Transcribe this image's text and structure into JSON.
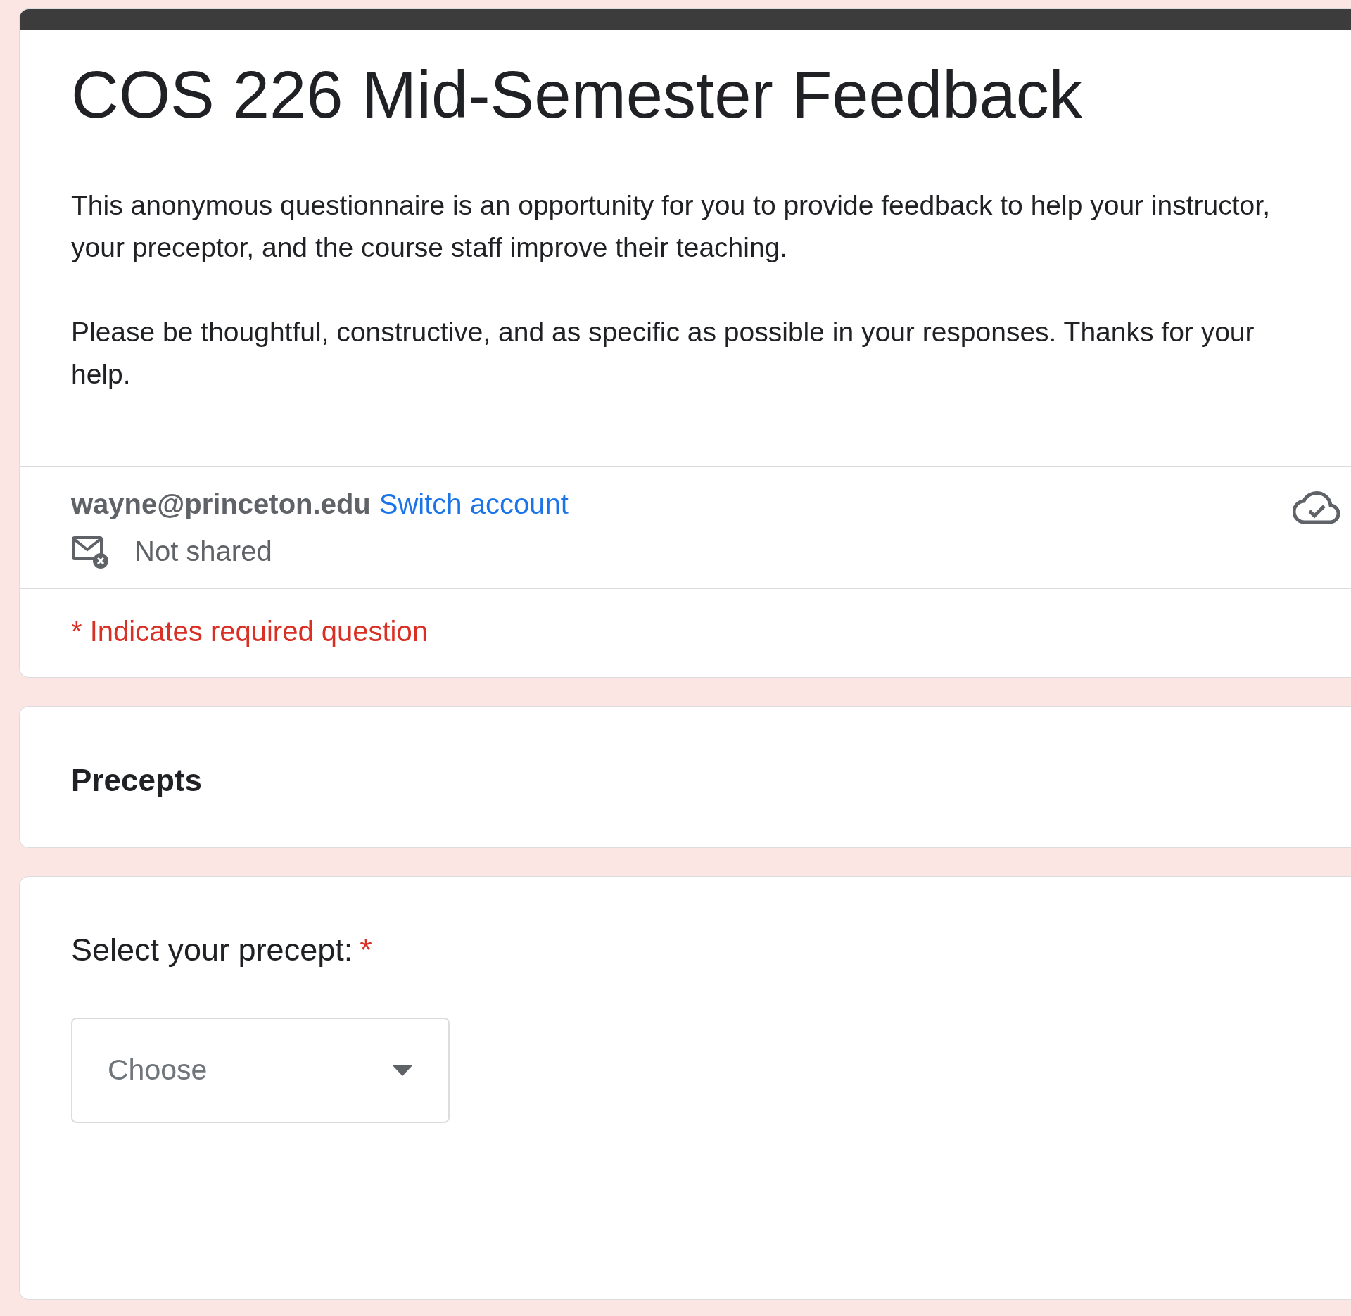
{
  "form": {
    "title": "COS 226 Mid-Semester Feedback",
    "description": [
      "This anonymous questionnaire is an opportunity for you to provide feedback to help your instructor, your preceptor, and the course staff improve their teaching.",
      "Please be thoughtful, constructive, and as specific as possible in your responses. Thanks for your help."
    ]
  },
  "account": {
    "email": "wayne@princeton.edu",
    "switch_link": "Switch account",
    "privacy": "Not shared"
  },
  "required_note": "* Indicates required question",
  "items": [
    {
      "kind": "section",
      "title": "Precepts"
    },
    {
      "kind": "question",
      "title": "Select your precept:",
      "required_mark": "*",
      "dropdown": {
        "placeholder": "Choose"
      }
    }
  ]
}
